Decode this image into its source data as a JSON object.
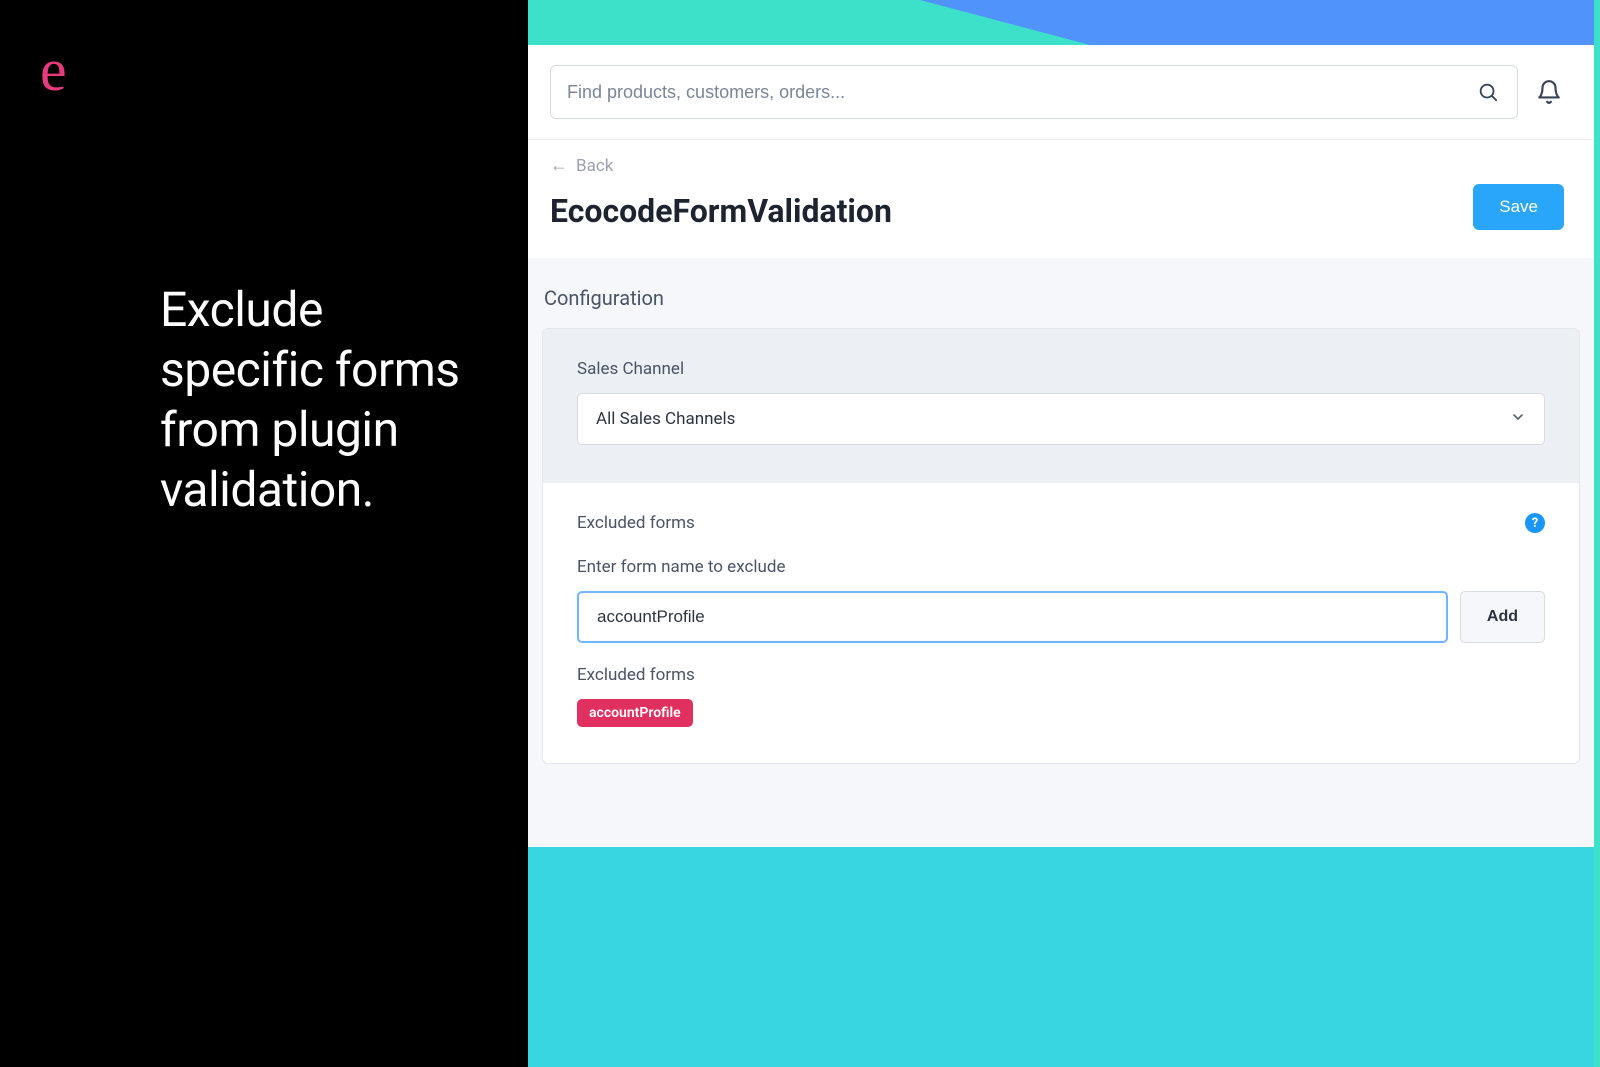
{
  "promo": {
    "logo_letter": "e",
    "headline": "Exclude specific forms from plugin validation."
  },
  "topbar": {
    "search_placeholder": "Find products, customers, orders..."
  },
  "header": {
    "back_label": "Back",
    "page_title": "EcocodeFormValidation",
    "save_label": "Save"
  },
  "config": {
    "section_title": "Configuration",
    "sales_channel_label": "Sales Channel",
    "sales_channel_value": "All Sales Channels",
    "excluded_forms_label": "Excluded forms",
    "enter_form_label": "Enter form name to exclude",
    "form_input_value": "accountProfile",
    "add_button_label": "Add",
    "excluded_list_label": "Excluded forms",
    "excluded_tags": [
      "accountProfile"
    ],
    "help_symbol": "?"
  }
}
